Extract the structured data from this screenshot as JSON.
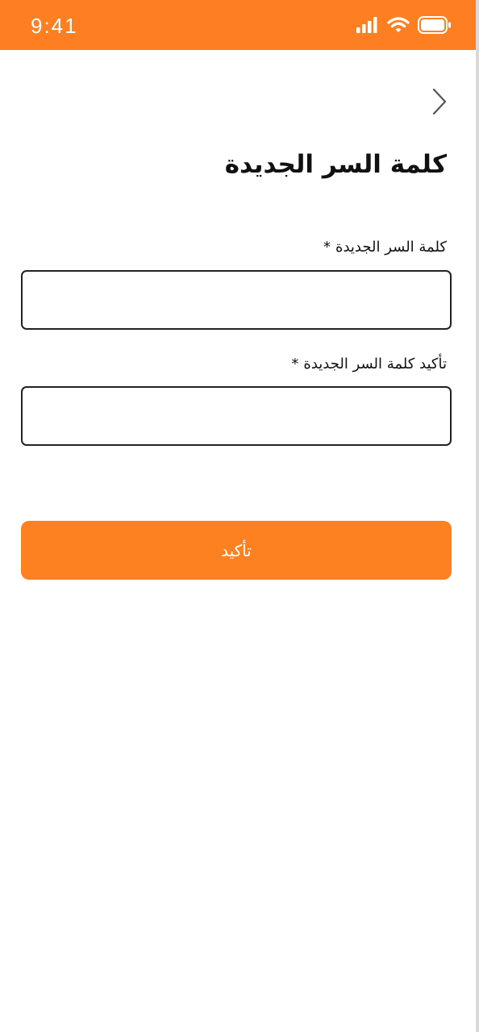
{
  "status_bar": {
    "time": "9:41",
    "icons": [
      "cellular-signal-icon",
      "wifi-icon",
      "battery-icon"
    ],
    "color": "#fd7f21"
  },
  "header": {
    "back_icon": "chevron-right-icon",
    "title": "كلمة السر الجديدة"
  },
  "form": {
    "new_password": {
      "label": "كلمة السر الجديدة",
      "required_mark": "*",
      "value": ""
    },
    "confirm_password": {
      "label": "تأكيد كلمة السر الجديدة",
      "required_mark": "*",
      "value": ""
    },
    "submit_label": "تأكيد",
    "accent_color": "#fd8121"
  }
}
